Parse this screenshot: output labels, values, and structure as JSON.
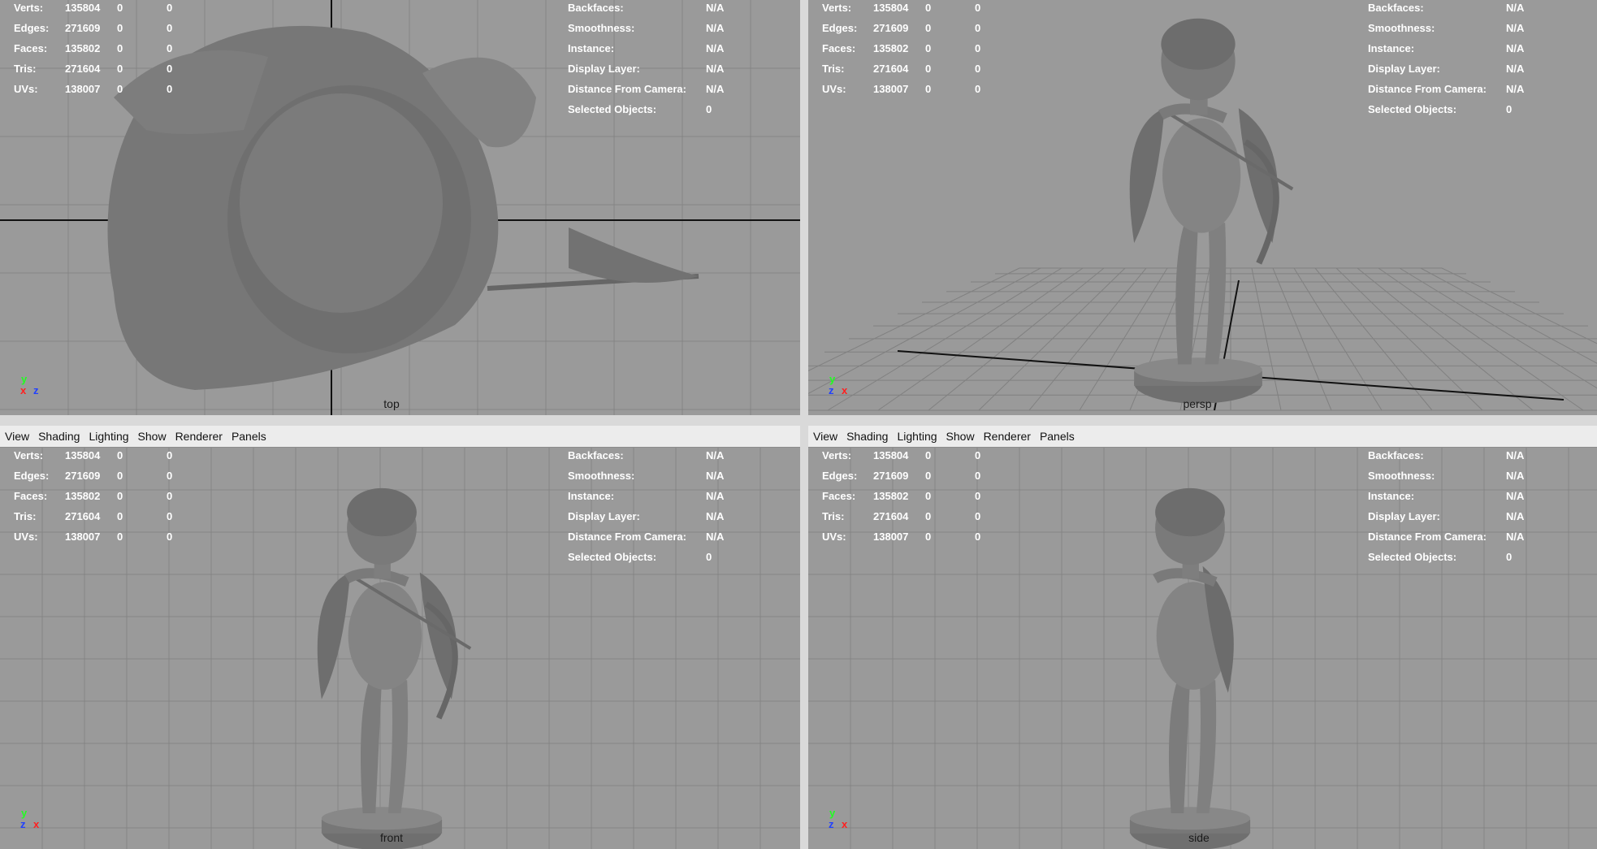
{
  "menu": [
    "View",
    "Shading",
    "Lighting",
    "Show",
    "Renderer",
    "Panels"
  ],
  "stats_left": [
    {
      "label": "Verts:",
      "v1": "135804",
      "v2": "0",
      "v3": "0"
    },
    {
      "label": "Edges:",
      "v1": "271609",
      "v2": "0",
      "v3": "0"
    },
    {
      "label": "Faces:",
      "v1": "135802",
      "v2": "0",
      "v3": "0"
    },
    {
      "label": "Tris:",
      "v1": "271604",
      "v2": "0",
      "v3": "0"
    },
    {
      "label": "UVs:",
      "v1": "138007",
      "v2": "0",
      "v3": "0"
    }
  ],
  "stats_right": [
    {
      "label": "Backfaces:",
      "value": "N/A"
    },
    {
      "label": "Smoothness:",
      "value": "N/A"
    },
    {
      "label": "Instance:",
      "value": "N/A"
    },
    {
      "label": "Display Layer:",
      "value": "N/A"
    },
    {
      "label": "Distance From Camera:",
      "value": "N/A"
    },
    {
      "label": "Selected Objects:",
      "value": "0"
    }
  ],
  "viewports": [
    {
      "camera": "top",
      "axes": [
        "y",
        "x",
        "z"
      ],
      "menubar": false
    },
    {
      "camera": "persp",
      "axes": [
        "y",
        "z",
        "x"
      ],
      "menubar": false
    },
    {
      "camera": "front",
      "axes": [
        "y",
        "z",
        "x"
      ],
      "menubar": true
    },
    {
      "camera": "side",
      "axes": [
        "y",
        "z",
        "x"
      ],
      "menubar": true
    }
  ],
  "colors": {
    "hud_text": "#ffffff",
    "axis_x": "#ff2020",
    "axis_y": "#20ff20",
    "axis_z": "#2040ff",
    "grid": "#858585",
    "viewport_bg": "#9a9a9a"
  }
}
